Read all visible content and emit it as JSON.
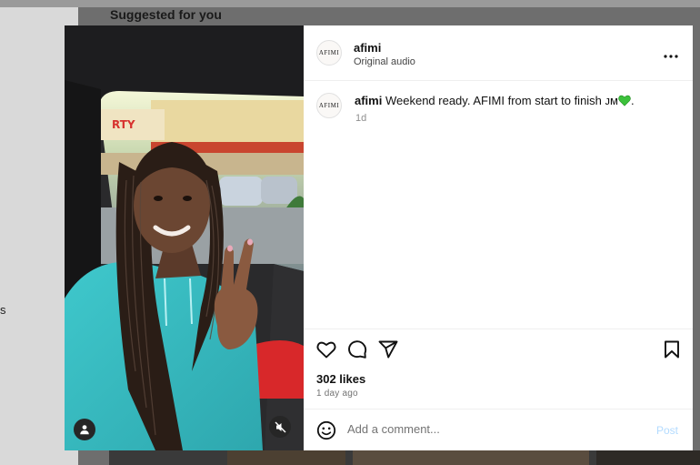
{
  "page": {
    "section_title": "Suggested for you",
    "side_fragment": "s"
  },
  "post": {
    "author": {
      "username": "afimi",
      "avatar_text": "AFIMI",
      "audio": "Original audio"
    },
    "caption": {
      "username": "afimi",
      "text": "Weekend ready. AFIMI from start to finish ᴊᴍ",
      "emoji": "green-heart",
      "trailing": ".",
      "time": "1d"
    },
    "likes": "302 likes",
    "posted_ago": "1 day ago",
    "comment_box": {
      "placeholder": "Add a comment...",
      "post_label": "Post"
    },
    "media_controls": {
      "tag_icon": "user-tag-icon",
      "mute_icon": "muted-speaker-icon"
    }
  },
  "colors": {
    "brand_link": "#0095f6",
    "post_disabled": "#b3dbff",
    "jersey": "#3bbfc2"
  }
}
